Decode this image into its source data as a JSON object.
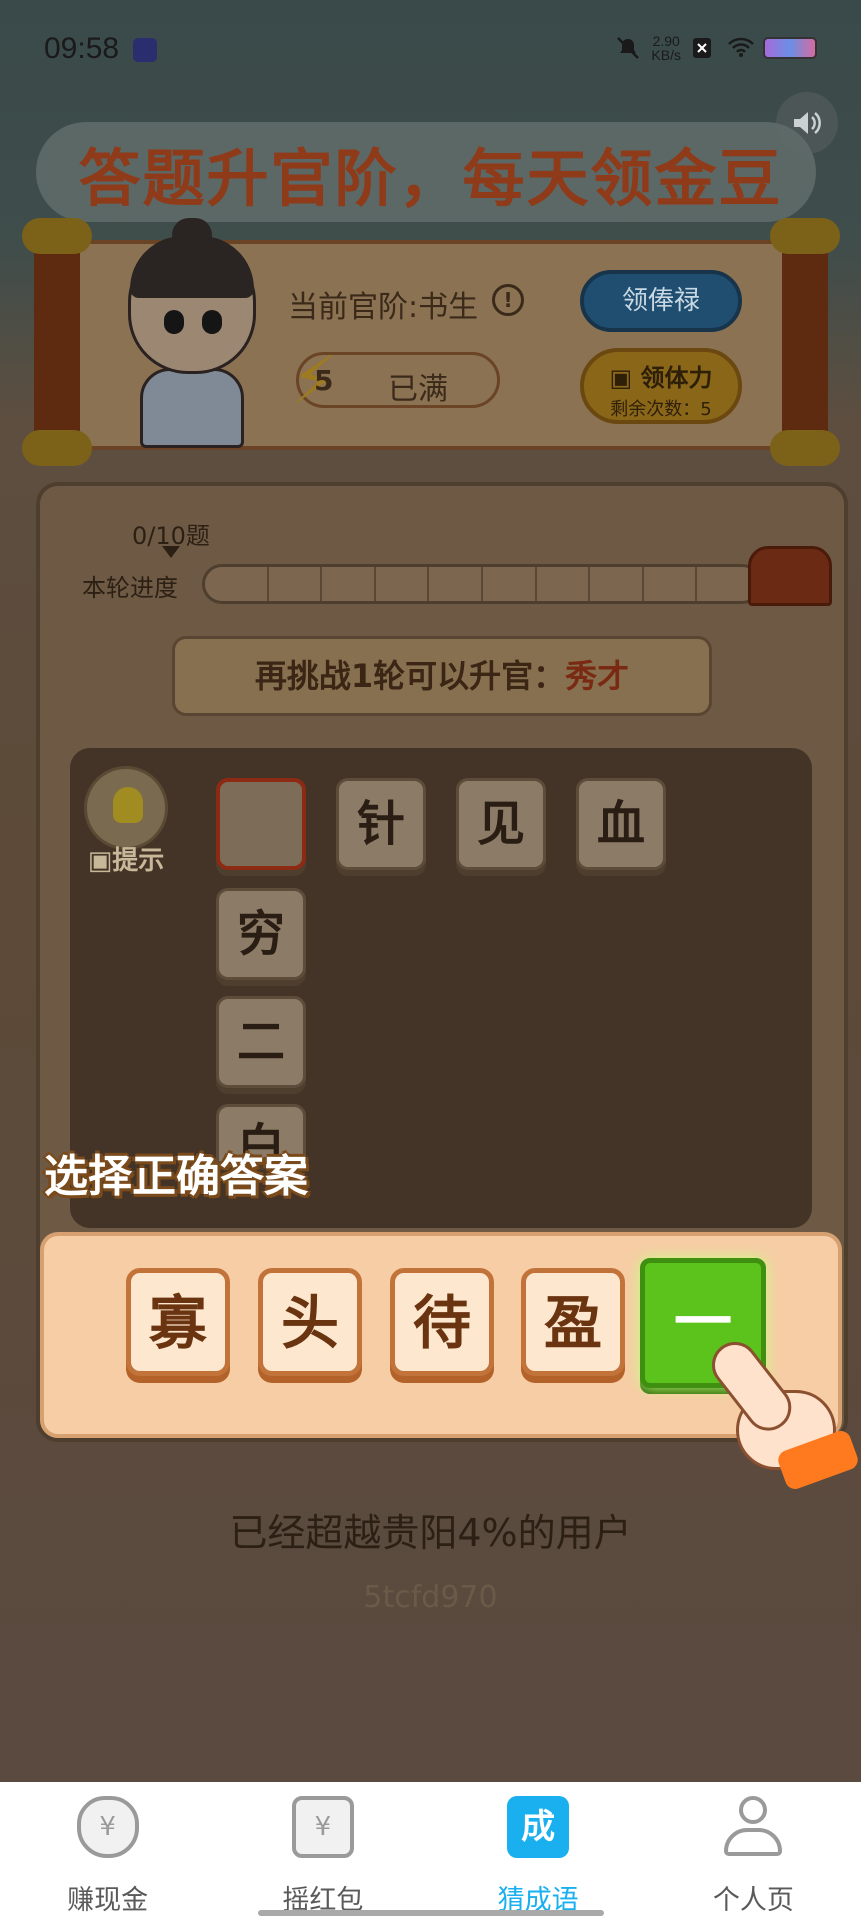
{
  "status_bar": {
    "time": "09:58",
    "net_speed_value": "2.90",
    "net_speed_unit": "KB/s",
    "icons": [
      "mute-icon",
      "sim-x-icon",
      "wifi-icon",
      "battery-icon"
    ]
  },
  "header": {
    "title": "答题升官阶，每天领金豆",
    "sound_icon": "speaker-icon"
  },
  "rank_panel": {
    "current_rank": "当前官阶:书生",
    "info_icon": "!",
    "energy_count": "5",
    "energy_status": "已满",
    "salary_button": "领俸禄",
    "stamina_button": "领体力",
    "stamina_remaining": "剩余次数：5"
  },
  "progress": {
    "count_label": "0/10题",
    "label": "本轮进度",
    "value": 0,
    "total": 10
  },
  "promotion": {
    "text": "再挑战1轮可以升官：",
    "next_rank": "秀才"
  },
  "puzzle": {
    "hint_label": "提示",
    "row_tiles": [
      "",
      "针",
      "见",
      "血"
    ],
    "column_tiles": [
      "穷",
      "二"
    ],
    "partial_tile": "白"
  },
  "overlay_instruction": "选择正确答案",
  "options": [
    "寡",
    "头",
    "待",
    "盈",
    "一"
  ],
  "selected_option_index": 4,
  "footer": {
    "beat_text": "已经超越贵阳4%的用户",
    "user_id": "5tcfd970"
  },
  "bottom_nav": [
    {
      "label": "赚现金",
      "icon": "money-bag-icon",
      "glyph": "¥"
    },
    {
      "label": "摇红包",
      "icon": "red-packet-icon",
      "glyph": "¥"
    },
    {
      "label": "猜成语",
      "icon": "idiom-icon",
      "glyph": "成",
      "active": true
    },
    {
      "label": "个人页",
      "icon": "profile-icon"
    }
  ],
  "colors": {
    "accent": "#1ab0f0",
    "selected_option": "#5cc21c",
    "option_border": "#c2733a",
    "title": "#8f3a18"
  }
}
